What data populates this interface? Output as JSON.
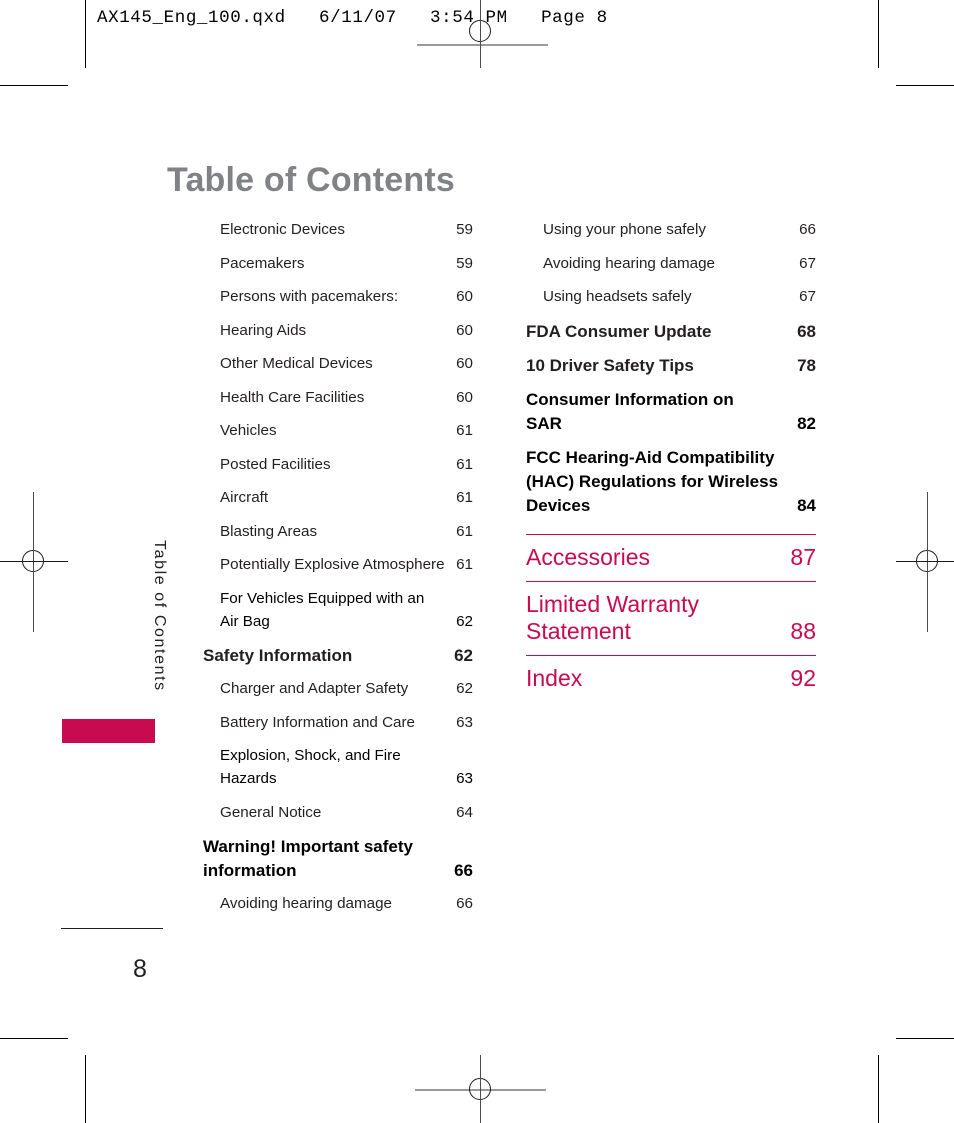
{
  "header": {
    "print_info": "AX145_Eng_100.qxd   6/11/07   3:54 PM   Page 8"
  },
  "page_title": "Table of Contents",
  "side_tab": {
    "label": "Table of Contents"
  },
  "folio": {
    "page_number": "8"
  },
  "colors": {
    "accent_pink": "#c80a50",
    "title_grey": "#808285",
    "body_black": "#231f20"
  },
  "toc": {
    "left_column": [
      {
        "level": 2,
        "label": "Electronic Devices",
        "page": "59"
      },
      {
        "level": 2,
        "label": "Pacemakers",
        "page": "59"
      },
      {
        "level": 2,
        "label": "Persons with pacemakers:",
        "page": "60"
      },
      {
        "level": 2,
        "label": "Hearing Aids",
        "page": "60"
      },
      {
        "level": 2,
        "label": "Other Medical Devices",
        "page": "60"
      },
      {
        "level": 2,
        "label": "Health Care Facilities",
        "page": "60"
      },
      {
        "level": 2,
        "label": "Vehicles",
        "page": "61"
      },
      {
        "level": 2,
        "label": "Posted Facilities",
        "page": "61"
      },
      {
        "level": 2,
        "label": "Aircraft",
        "page": "61"
      },
      {
        "level": 2,
        "label": "Blasting Areas",
        "page": "61"
      },
      {
        "level": 2,
        "label": "Potentially Explosive Atmosphere",
        "page": "61"
      },
      {
        "level": 2,
        "line1": "For Vehicles Equipped with an",
        "line2": "Air Bag",
        "page": "62"
      },
      {
        "level": 1,
        "label": "Safety Information",
        "page": "62"
      },
      {
        "level": 2,
        "label": "Charger and Adapter Safety",
        "page": "62"
      },
      {
        "level": 2,
        "label": "Battery Information and Care",
        "page": "63"
      },
      {
        "level": 2,
        "line1": "Explosion, Shock, and Fire",
        "line2": "Hazards",
        "page": "63"
      },
      {
        "level": 2,
        "label": "General Notice",
        "page": "64"
      },
      {
        "level": 1,
        "line1": "Warning! Important safety",
        "line2": "information",
        "page": "66"
      },
      {
        "level": 2,
        "label": "Avoiding hearing damage",
        "page": "66"
      }
    ],
    "right_column": [
      {
        "level": 2,
        "label": "Using your phone safely",
        "page": "66"
      },
      {
        "level": 2,
        "label": "Avoiding hearing damage",
        "page": "67"
      },
      {
        "level": 2,
        "label": "Using headsets safely",
        "page": "67"
      },
      {
        "level": 1,
        "label": "FDA Consumer Update",
        "page": "68"
      },
      {
        "level": 1,
        "label": "10 Driver Safety Tips",
        "page": "78"
      },
      {
        "level": 1,
        "line1": "Consumer Information on",
        "line2": "SAR",
        "page": "82"
      },
      {
        "level": 1,
        "line0": "FCC Hearing-Aid Compatibility",
        "line1": "(HAC) Regulations for Wireless",
        "line2": "Devices",
        "page": "84"
      }
    ],
    "pink_section": [
      {
        "label": "Accessories",
        "page": "87"
      },
      {
        "line1": "Limited Warranty",
        "line2": "Statement",
        "page": "88"
      },
      {
        "label": "Index",
        "page": "92"
      }
    ]
  }
}
